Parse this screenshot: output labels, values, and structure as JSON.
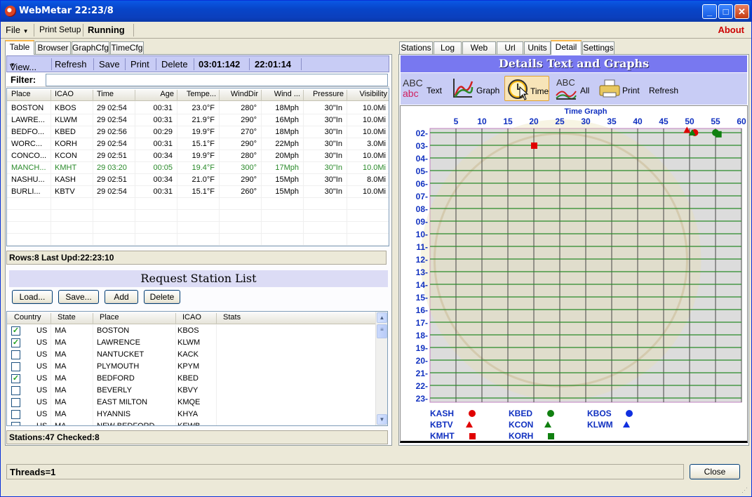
{
  "window": {
    "title": "WebMetar 22:23/8"
  },
  "menu": {
    "file": "File",
    "print_setup": "Print Setup",
    "running": "Running",
    "about": "About"
  },
  "left_tabs": [
    "Table",
    "Browser",
    "GraphCfg",
    "TimeCfg"
  ],
  "right_tabs": [
    "Stations",
    "Log",
    "Web",
    "Url",
    "Units",
    "Detail",
    "Settings"
  ],
  "toolbar": {
    "view": "View...",
    "refresh": "Refresh",
    "save": "Save",
    "print": "Print",
    "delete": "Delete",
    "time1": "03:01:142",
    "time2": "22:01:14"
  },
  "filter": {
    "label": "Filter:",
    "value": ""
  },
  "metar_table": {
    "columns": [
      "Place",
      "ICAO",
      "Time",
      "Age",
      "Tempe...",
      "WindDir",
      "Wind ...",
      "Pressure",
      "Visibility"
    ],
    "rows": [
      [
        "BOSTON",
        "KBOS",
        "29 02:54",
        "00:31",
        "23.0°F",
        "280°",
        "18Mph",
        "30\"In",
        "10.0Mi"
      ],
      [
        "LAWRE...",
        "KLWM",
        "29 02:54",
        "00:31",
        "21.9°F",
        "290°",
        "16Mph",
        "30\"In",
        "10.0Mi"
      ],
      [
        "BEDFO...",
        "KBED",
        "29 02:56",
        "00:29",
        "19.9°F",
        "270°",
        "18Mph",
        "30\"In",
        "10.0Mi"
      ],
      [
        "WORC...",
        "KORH",
        "29 02:54",
        "00:31",
        "15.1°F",
        "290°",
        "22Mph",
        "30\"In",
        "3.0Mi"
      ],
      [
        "CONCO...",
        "KCON",
        "29 02:51",
        "00:34",
        "19.9°F",
        "280°",
        "20Mph",
        "30\"In",
        "10.0Mi"
      ],
      [
        "MANCH...",
        "KMHT",
        "29 03:20",
        "00:05",
        "19.4°F",
        "300°",
        "17Mph",
        "30\"In",
        "10.0Mi"
      ],
      [
        "NASHU...",
        "KASH",
        "29 02:51",
        "00:34",
        "21.0°F",
        "290°",
        "15Mph",
        "30\"In",
        "8.0Mi"
      ],
      [
        "BURLI...",
        "KBTV",
        "29 02:54",
        "00:31",
        "15.1°F",
        "260°",
        "15Mph",
        "30\"In",
        "10.0Mi"
      ]
    ],
    "highlight_row": 5,
    "highlight_color": "#2a8a2a"
  },
  "table_status": "Rows:8  Last Upd:22:23:10",
  "request_list": {
    "title": "Request Station List",
    "buttons": [
      "Load...",
      "Save...",
      "Add",
      "Delete"
    ],
    "columns": [
      "Country",
      "State",
      "Place",
      "ICAO",
      "Stats"
    ],
    "rows": [
      {
        "checked": true,
        "country": "US",
        "state": "MA",
        "place": "BOSTON",
        "icao": "KBOS"
      },
      {
        "checked": true,
        "country": "US",
        "state": "MA",
        "place": "LAWRENCE",
        "icao": "KLWM"
      },
      {
        "checked": false,
        "country": "US",
        "state": "MA",
        "place": "NANTUCKET",
        "icao": "KACK"
      },
      {
        "checked": false,
        "country": "US",
        "state": "MA",
        "place": "PLYMOUTH",
        "icao": "KPYM"
      },
      {
        "checked": true,
        "country": "US",
        "state": "MA",
        "place": "BEDFORD",
        "icao": "KBED"
      },
      {
        "checked": false,
        "country": "US",
        "state": "MA",
        "place": "BEVERLY",
        "icao": "KBVY"
      },
      {
        "checked": false,
        "country": "US",
        "state": "MA",
        "place": "EAST MILTON",
        "icao": "KMQE"
      },
      {
        "checked": false,
        "country": "US",
        "state": "MA",
        "place": "HYANNIS",
        "icao": "KHYA"
      },
      {
        "checked": false,
        "country": "US",
        "state": "MA",
        "place": "NEW BEDFORD",
        "icao": "KEWB"
      }
    ]
  },
  "stations_status": "Stations:47   Checked:8",
  "detail": {
    "header": "Details Text and Graphs",
    "tools": [
      "Text",
      "Graph",
      "Time",
      "All",
      "Print",
      "Refresh"
    ],
    "selected_tool": "Time"
  },
  "chart_data": {
    "type": "scatter",
    "title": "Time Graph",
    "x_ticks": [
      "5",
      "10",
      "15",
      "20",
      "25",
      "30",
      "35",
      "40",
      "45",
      "50",
      "55",
      "60"
    ],
    "y_ticks": [
      "02-",
      "03-",
      "04-",
      "05-",
      "06-",
      "07-",
      "08-",
      "09-",
      "10-",
      "11-",
      "12-",
      "13-",
      "14-",
      "15-",
      "16-",
      "17-",
      "18-",
      "19-",
      "20-",
      "21-",
      "22-",
      "23-"
    ],
    "xlim": [
      0,
      60
    ],
    "ylim": [
      2,
      23
    ],
    "series": [
      {
        "name": "KASH",
        "color": "#e00000",
        "marker": "circle",
        "points": [
          [
            51,
            2
          ]
        ]
      },
      {
        "name": "KBTV",
        "color": "#e00000",
        "marker": "triangle",
        "points": [
          [
            49.5,
            1.8
          ]
        ]
      },
      {
        "name": "KMHT",
        "color": "#e00000",
        "marker": "square",
        "points": [
          [
            20,
            3
          ]
        ]
      },
      {
        "name": "KBED",
        "color": "#108010",
        "marker": "circle",
        "points": [
          [
            55,
            2
          ]
        ]
      },
      {
        "name": "KCON",
        "color": "#108010",
        "marker": "triangle",
        "points": [
          [
            50.5,
            2
          ]
        ]
      },
      {
        "name": "KORH",
        "color": "#108010",
        "marker": "square",
        "points": [
          [
            55.5,
            2.1
          ]
        ]
      },
      {
        "name": "KBOS",
        "color": "#1030e0",
        "marker": "circle",
        "points": []
      },
      {
        "name": "KLWM",
        "color": "#1030e0",
        "marker": "triangle",
        "points": []
      }
    ]
  },
  "threads": "Threads=1",
  "close_button": "Close"
}
